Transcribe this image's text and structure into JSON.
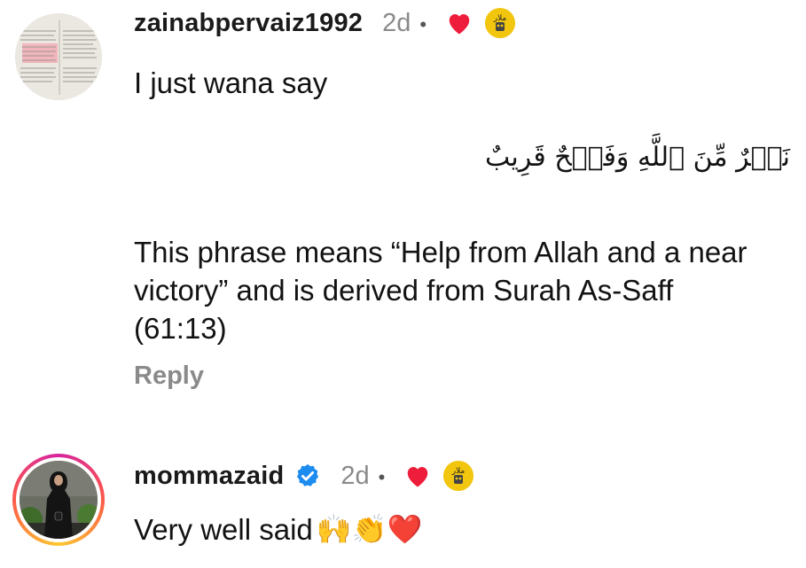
{
  "comments": [
    {
      "username": "zainabpervaiz1992",
      "time": "2d",
      "dot": "•",
      "text_line1": "I just wana say",
      "arabic": "نَصۡرٌ مِّنَ ٱللَّهِ وَفَتۡحٌ قَرِيبٌ",
      "paragraph": "This phrase means “Help from Allah and a near victory” and is derived from Surah As-Saff (61:13)",
      "reply_label": "Reply",
      "liked_heart_color": "#ee1d3b"
    },
    {
      "username": "mommazaid",
      "time": "2d",
      "dot": "•",
      "verified_icon": "verified-badge-icon",
      "text": "Very well said",
      "emojis": "🙌👏❤️",
      "liked_heart_color": "#ee1d3b"
    }
  ],
  "colors": {
    "verified_blue": "#1d8cf0",
    "muted_text": "#8a8a8a",
    "badge_yellow": "#f2c60e"
  }
}
